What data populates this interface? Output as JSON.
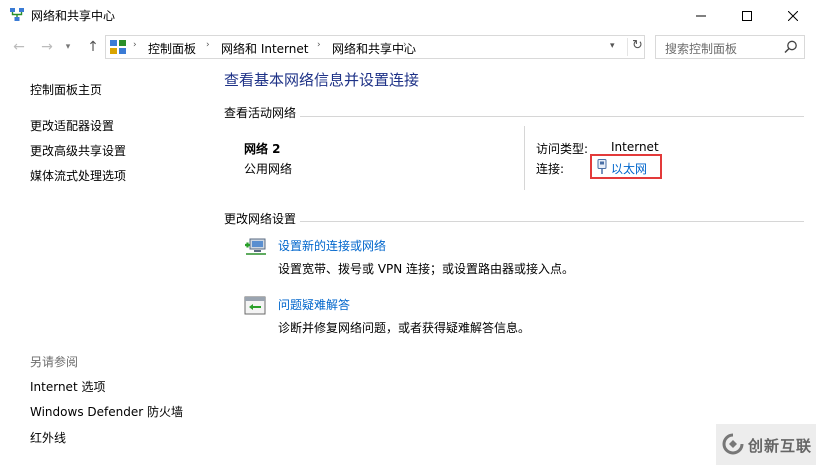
{
  "window": {
    "title": "网络和共享中心"
  },
  "address": {
    "crumbs": [
      "控制面板",
      "网络和 Internet",
      "网络和共享中心"
    ],
    "search_placeholder": "搜索控制面板"
  },
  "sidebar": {
    "items": [
      "控制面板主页",
      "更改适配器设置",
      "更改高级共享设置",
      "媒体流式处理选项"
    ],
    "see_also_label": "另请参阅",
    "see_also_items": [
      "Internet 选项",
      "Windows Defender 防火墙",
      "红外线"
    ]
  },
  "main": {
    "heading": "查看基本网络信息并设置连接",
    "active_networks_label": "查看活动网络",
    "network": {
      "name": "网络 2",
      "type": "公用网络",
      "access_type_label": "访问类型:",
      "access_type_value": "Internet",
      "connection_label": "连接:",
      "connection_value": "以太网"
    },
    "change_settings_label": "更改网络设置",
    "tasks": [
      {
        "title": "设置新的连接或网络",
        "desc": "设置宽带、拨号或 VPN 连接；或设置路由器或接入点。",
        "icon": "new-connection-icon"
      },
      {
        "title": "问题疑难解答",
        "desc": "诊断并修复网络问题，或者获得疑难解答信息。",
        "icon": "troubleshoot-icon"
      }
    ]
  },
  "watermark": {
    "text": "创新互联"
  },
  "colors": {
    "heading": "#1e3287",
    "link": "#0066cc",
    "highlight_box": "#e33a3a"
  }
}
